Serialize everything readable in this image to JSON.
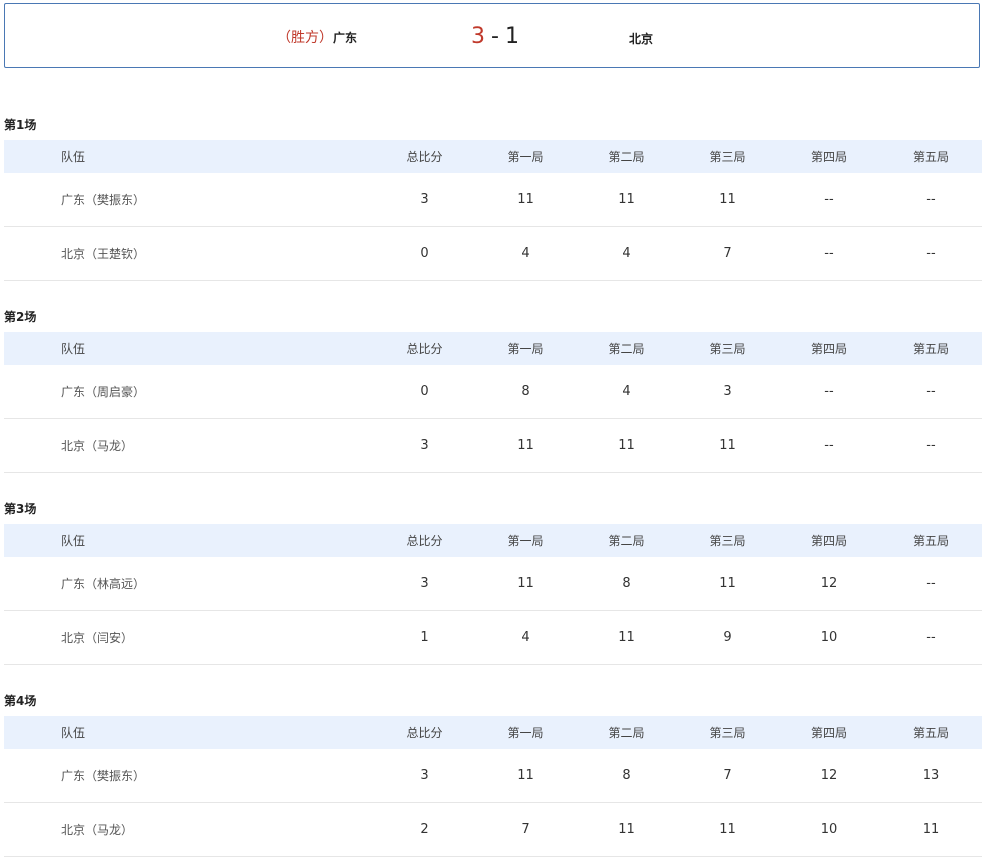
{
  "scoreboard": {
    "winner_tag": "（胜方）",
    "team_a": "广东",
    "score_a": "3",
    "separator": "-",
    "score_b": "1",
    "team_b": "北京"
  },
  "headers": [
    "队伍",
    "总比分",
    "第一局",
    "第二局",
    "第三局",
    "第四局",
    "第五局"
  ],
  "matches": [
    {
      "title": "第1场",
      "rows": [
        [
          "广东（樊振东）",
          "3",
          "11",
          "11",
          "11",
          "--",
          "--"
        ],
        [
          "北京（王楚钦）",
          "0",
          "4",
          "4",
          "7",
          "--",
          "--"
        ]
      ]
    },
    {
      "title": "第2场",
      "rows": [
        [
          "广东（周启豪）",
          "0",
          "8",
          "4",
          "3",
          "--",
          "--"
        ],
        [
          "北京（马龙）",
          "3",
          "11",
          "11",
          "11",
          "--",
          "--"
        ]
      ]
    },
    {
      "title": "第3场",
      "rows": [
        [
          "广东（林高远）",
          "3",
          "11",
          "8",
          "11",
          "12",
          "--"
        ],
        [
          "北京（闫安）",
          "1",
          "4",
          "11",
          "9",
          "10",
          "--"
        ]
      ]
    },
    {
      "title": "第4场",
      "rows": [
        [
          "广东（樊振东）",
          "3",
          "11",
          "8",
          "7",
          "12",
          "13"
        ],
        [
          "北京（马龙）",
          "2",
          "7",
          "11",
          "11",
          "10",
          "11"
        ]
      ]
    }
  ]
}
